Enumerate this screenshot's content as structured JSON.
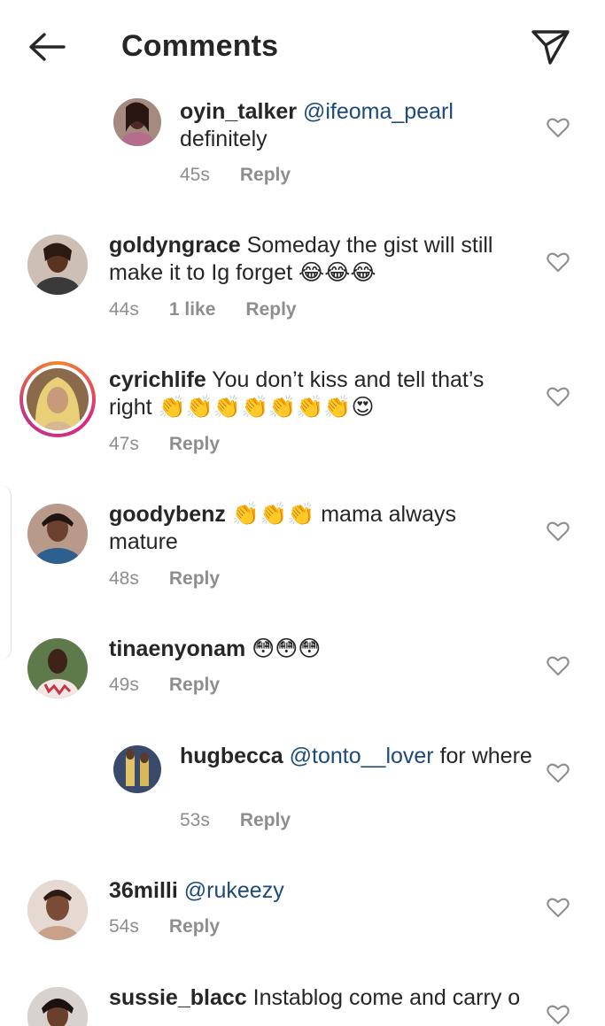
{
  "header": {
    "title": "Comments"
  },
  "comments": [
    {
      "username": "oyin_talker",
      "mention": "@ifeoma_pearl",
      "text": " definitely",
      "time": "45s",
      "likes": "",
      "reply": "Reply"
    },
    {
      "username": "goldyngrace",
      "mention": "",
      "text": " Someday the gist will still make it to Ig forget 😂😂😂",
      "time": "44s",
      "likes": "1 like",
      "reply": "Reply"
    },
    {
      "username": "cyrichlife",
      "mention": "",
      "text": " You don’t kiss and tell that’s right 👏👏👏👏👏👏👏😍",
      "time": "47s",
      "likes": "",
      "reply": "Reply"
    },
    {
      "username": "goodybenz",
      "mention": "",
      "text": " 👏👏👏 mama always mature",
      "time": "48s",
      "likes": "",
      "reply": "Reply"
    },
    {
      "username": "tinaenyonam",
      "mention": "",
      "text": " 😳😳😳",
      "time": "49s",
      "likes": "",
      "reply": "Reply"
    },
    {
      "username": "hugbecca",
      "mention": "@tonto__lover",
      "text": " for where",
      "time": "53s",
      "likes": "",
      "reply": "Reply"
    },
    {
      "username": "36milli",
      "mention": "@rukeezy",
      "text": "",
      "time": "54s",
      "likes": "",
      "reply": "Reply"
    },
    {
      "username": "sussie_blacc",
      "mention": "",
      "text": " Instablog come and carry o",
      "time": "",
      "likes": "",
      "reply": ""
    }
  ],
  "icons": {
    "back": "arrow-left-icon",
    "send": "paper-plane-icon",
    "like": "heart-outline-icon"
  },
  "colors": {
    "mention": "#1c4a7a",
    "meta": "#8e8e8e",
    "text": "#262626"
  }
}
